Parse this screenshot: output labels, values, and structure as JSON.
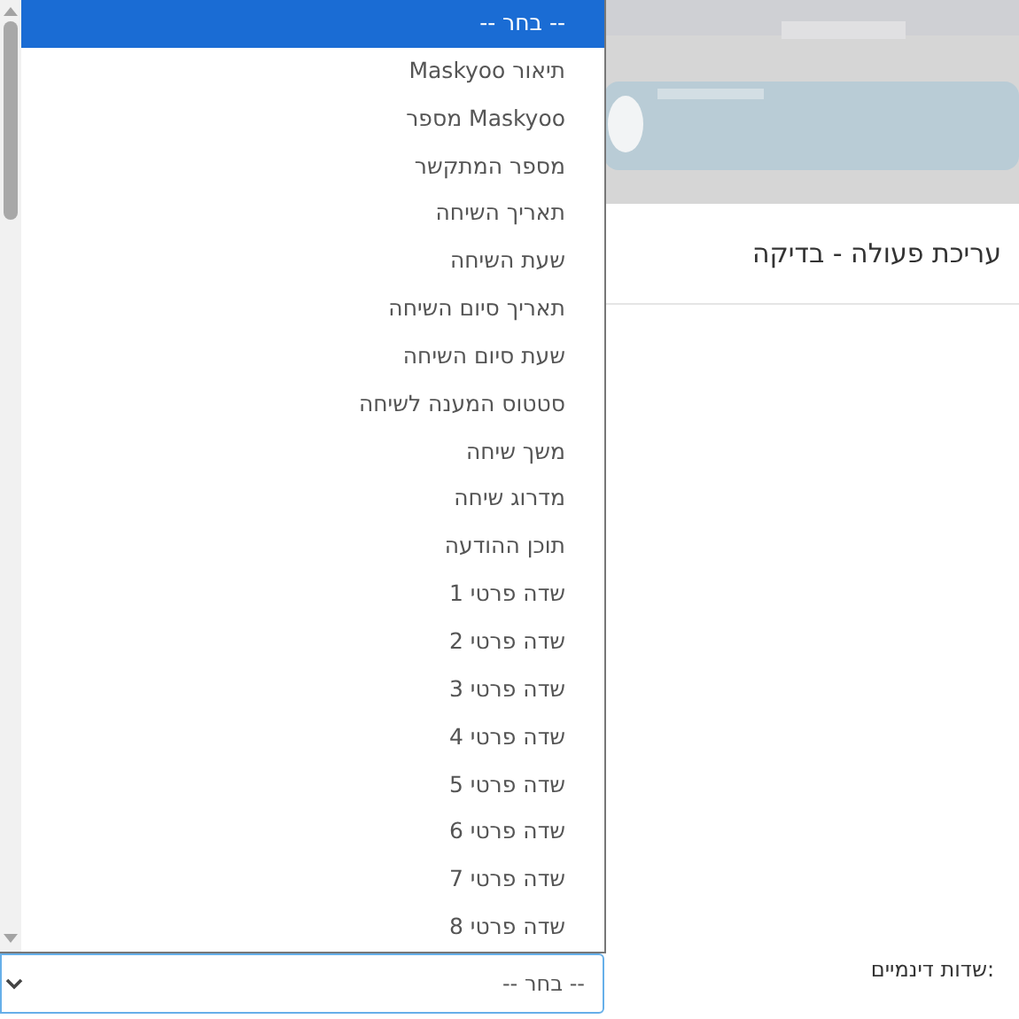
{
  "dialog_title": "עריכת פעולה - בדיקה",
  "field_label": "שדות דינמיים:",
  "select": {
    "value": "-- בחר --",
    "expanded": true
  },
  "options": [
    {
      "label": "-- בחר --",
      "selected": true
    },
    {
      "label": "תיאור Maskyoo",
      "selected": false
    },
    {
      "label": "Maskyoo מספר",
      "selected": false
    },
    {
      "label": "מספר המתקשר",
      "selected": false
    },
    {
      "label": "תאריך השיחה",
      "selected": false
    },
    {
      "label": "שעת השיחה",
      "selected": false
    },
    {
      "label": "תאריך סיום השיחה",
      "selected": false
    },
    {
      "label": "שעת סיום השיחה",
      "selected": false
    },
    {
      "label": "סטטוס המענה לשיחה",
      "selected": false
    },
    {
      "label": "משך שיחה",
      "selected": false
    },
    {
      "label": "מדרוג שיחה",
      "selected": false
    },
    {
      "label": "תוכן ההודעה",
      "selected": false
    },
    {
      "label": "שדה פרטי 1",
      "selected": false
    },
    {
      "label": "שדה פרטי 2",
      "selected": false
    },
    {
      "label": "שדה פרטי 3",
      "selected": false
    },
    {
      "label": "שדה פרטי 4",
      "selected": false
    },
    {
      "label": "שדה פרטי 5",
      "selected": false
    },
    {
      "label": "שדה פרטי 6",
      "selected": false
    },
    {
      "label": "שדה פרטי 7",
      "selected": false
    },
    {
      "label": "שדה פרטי 8",
      "selected": false
    }
  ]
}
